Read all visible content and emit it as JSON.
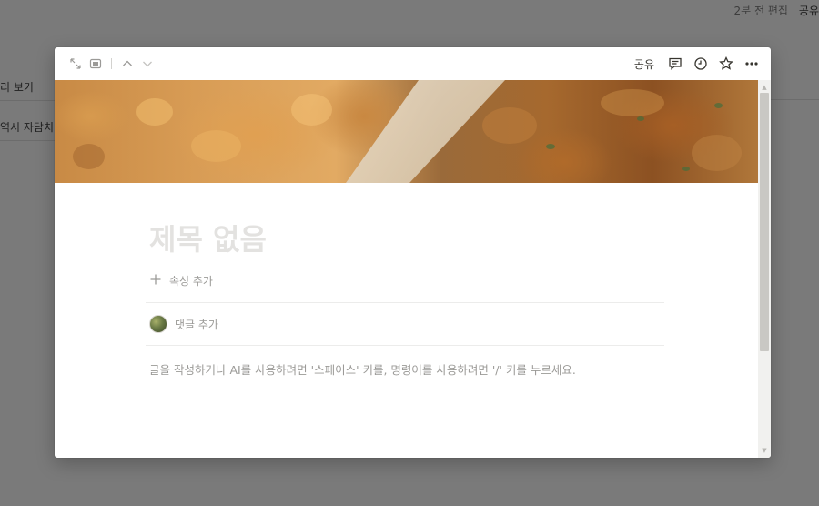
{
  "background": {
    "edited_text": "2분 전 편집",
    "share_label": "공유",
    "rows": [
      "리 보기",
      "역시 자담치"
    ]
  },
  "modal": {
    "toolbar": {
      "left_icons": [
        "expand-icon",
        "page-mode-icon",
        "chevron-up-icon",
        "chevron-down-icon"
      ],
      "share_label": "공유",
      "right_icons": [
        "comment-icon",
        "history-icon",
        "star-icon",
        "more-icon"
      ]
    },
    "cover": {
      "description_icon": "cover-image"
    },
    "page": {
      "title_placeholder": "제목 없음",
      "add_property_label": "속성 추가",
      "add_comment_label": "댓글 추가",
      "body_placeholder": "글을 작성하거나 AI를 사용하려면 '스페이스' 키를, 명령어를 사용하려면 '/' 키를 누르세요."
    }
  },
  "colors": {
    "overlay": "#7a7a7a",
    "modal_bg": "#ffffff",
    "placeholder_text": "#9b9a97",
    "title_placeholder": "#e3e2e0"
  }
}
